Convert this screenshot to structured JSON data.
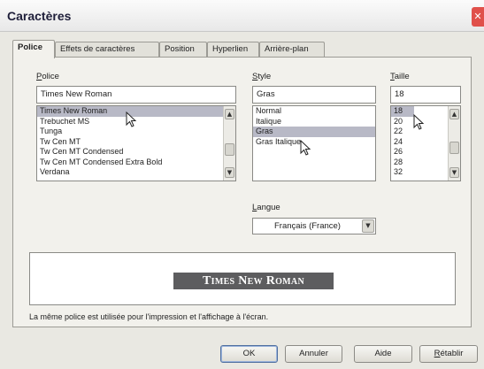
{
  "window": {
    "title": "Caractères",
    "close_glyph": "✕"
  },
  "tabs": [
    {
      "label": "Police",
      "active": true
    },
    {
      "label": "Effets de caractères",
      "active": false
    },
    {
      "label": "Position",
      "active": false
    },
    {
      "label": "Hyperlien",
      "active": false
    },
    {
      "label": "Arrière-plan",
      "active": false
    }
  ],
  "font": {
    "label_accel": "P",
    "label_rest": "olice",
    "value": "Times New Roman",
    "items": [
      "Times New Roman",
      "Trebuchet MS",
      "Tunga",
      "Tw Cen MT",
      "Tw Cen MT Condensed",
      "Tw Cen MT Condensed Extra Bold",
      "Verdana"
    ],
    "selected_index": 0
  },
  "style": {
    "label_accel": "S",
    "label_rest": "tyle",
    "value": "Gras",
    "items": [
      "Normal",
      "Italique",
      "Gras",
      "Gras Italique"
    ],
    "selected_index": 2
  },
  "size": {
    "label_accel": "T",
    "label_rest": "aille",
    "value": "18",
    "items": [
      "18",
      "20",
      "22",
      "24",
      "26",
      "28",
      "32"
    ],
    "selected_index": 0
  },
  "language": {
    "label_accel": "L",
    "label_rest": "angue",
    "value": "Français (France)"
  },
  "preview": {
    "text": "Times New Roman"
  },
  "note": "La même police est utilisée pour l'impression et l'affichage à l'écran.",
  "buttons": {
    "ok": "OK",
    "cancel": "Annuler",
    "help": "Aide",
    "reset_accel": "R",
    "reset_rest": "établir"
  },
  "icons": {
    "scroll_up": "▲",
    "scroll_down": "▼",
    "combo_down": "▼",
    "pointer": "mouse-pointer-icon"
  }
}
